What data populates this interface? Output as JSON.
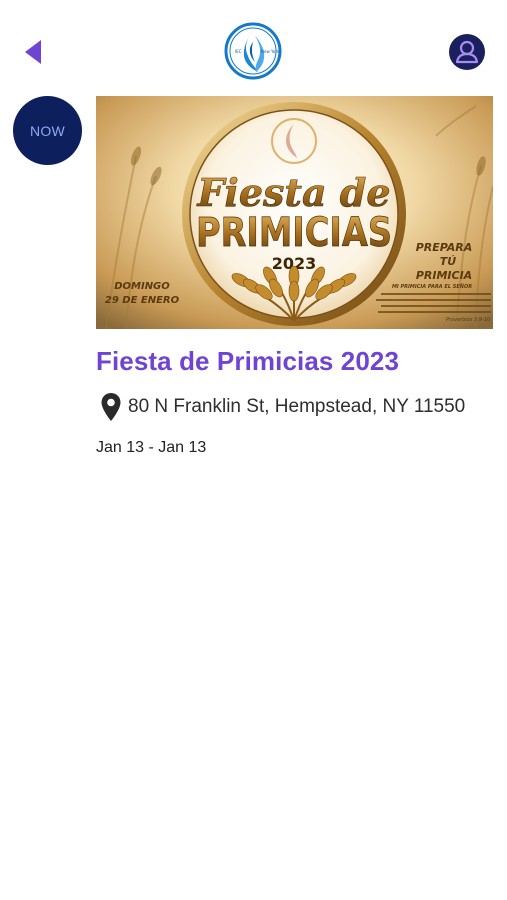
{
  "header": {
    "back_icon": "back-triangle-icon",
    "logo_icon": "church-flame-logo",
    "logo_text": "New York",
    "profile_icon": "user-avatar-icon",
    "accent_color": "#6f44d3",
    "profile_color": "#1a1f5e"
  },
  "badge": {
    "label": "NOW",
    "bg_color": "#0d1f5c"
  },
  "event": {
    "image": {
      "headline_line1": "Fiesta de",
      "headline_line2": "PRIMICIAS",
      "year": "2023",
      "side_left_line1": "DOMINGO",
      "side_left_line2": "29 DE ENERO",
      "side_right_line1": "PREPARA",
      "side_right_line2": "TÚ",
      "side_right_line3": "PRIMICIA",
      "side_right_line4": "MI PRIMICIA PARA EL SEÑOR",
      "verse": "Proverbios 3:9-10"
    },
    "title": "Fiesta de Primicias 2023",
    "location_icon": "map-pin-icon",
    "location": "80 N Franklin St, Hempstead, NY 11550",
    "dates": "Jan 13 - Jan 13"
  }
}
